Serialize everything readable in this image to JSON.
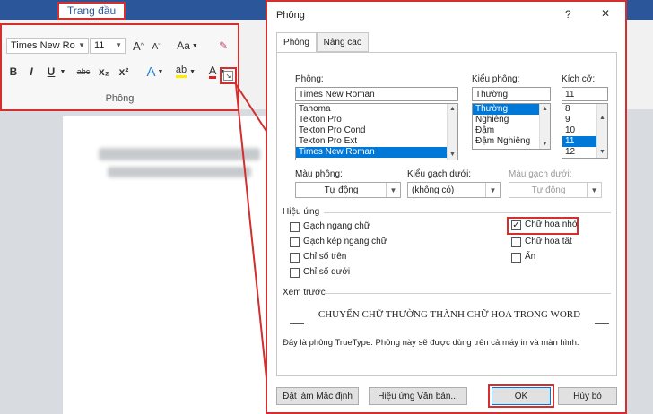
{
  "ribbon": {
    "tab_home": "Trang đầu",
    "font_name": "Times New Ro",
    "font_size": "11",
    "grow_font": "A",
    "shrink_font": "A",
    "change_case": "Aa",
    "bold": "B",
    "italic": "I",
    "underline": "U",
    "strikethrough": "abc",
    "subscript": "x₂",
    "superscript": "x²",
    "group_label": "Phông"
  },
  "dialog": {
    "title": "Phông",
    "help": "?",
    "close": "✕",
    "tabs": [
      "Phông",
      "Nâng cao"
    ],
    "font_label": "Phông:",
    "font_value": "Times New Roman",
    "font_list": [
      "Tahoma",
      "Tekton Pro",
      "Tekton Pro Cond",
      "Tekton Pro Ext",
      "Times New Roman"
    ],
    "style_label": "Kiểu phông:",
    "style_value": "Thường",
    "style_list": [
      "Thường",
      "Nghiêng",
      "Đậm",
      "Đậm Nghiêng"
    ],
    "size_label": "Kích cỡ:",
    "size_value": "11",
    "size_list": [
      "8",
      "9",
      "10",
      "11",
      "12"
    ],
    "font_color_label": "Màu phông:",
    "font_color_value": "Tự động",
    "underline_style_label": "Kiểu gạch dưới:",
    "underline_style_value": "(không có)",
    "underline_color_label": "Màu gạch dưới:",
    "underline_color_value": "Tự động",
    "effects_label": "Hiệu ứng",
    "effects_left": [
      {
        "label": "Gạch ngang chữ",
        "checked": false
      },
      {
        "label": "Gạch kép ngang chữ",
        "checked": false
      },
      {
        "label": "Chỉ số trên",
        "checked": false
      },
      {
        "label": "Chỉ số dưới",
        "checked": false
      }
    ],
    "effects_right": [
      {
        "label": "Chữ hoa nhỏ",
        "checked": true
      },
      {
        "label": "Chữ hoa tất",
        "checked": false
      },
      {
        "label": "Ẩn",
        "checked": false
      }
    ],
    "preview_label": "Xem trước",
    "preview_text": "CHUYỂN CHỮ THƯỜNG THÀNH CHỮ HOA TRONG WORD",
    "truetype_note": "Đây là phông TrueType. Phông này sẽ được dùng trên cả máy in và màn hình.",
    "set_default": "Đặt làm Mặc định",
    "text_effects": "Hiệu ứng Văn bản...",
    "ok": "OK",
    "cancel": "Hủy bỏ"
  },
  "colors": {
    "highlight_red": "#d32f2f",
    "selection_blue": "#0078d7",
    "word_blue": "#2b579a"
  }
}
